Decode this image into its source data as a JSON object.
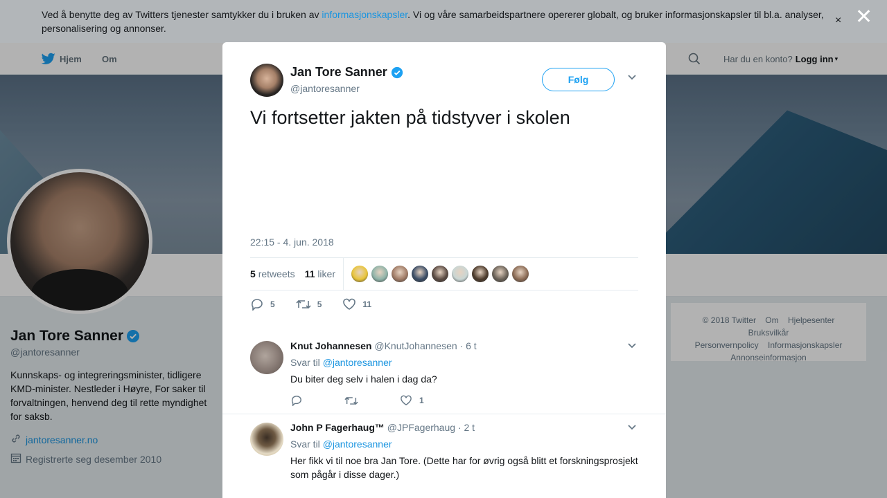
{
  "cookie_banner": {
    "text_before": "Ved å benytte deg av Twitters tjenester samtykker du i bruken av ",
    "link": "informasjonskapsler",
    "text_after": ". Vi og våre samarbeidspartnere opererer globalt, og bruker informasjonskapsler til bl.a. analyser, personalisering og annonser.",
    "close": "×"
  },
  "modal_close": "✕",
  "nav": {
    "home": "Hjem",
    "about": "Om",
    "have_account": "Har du en konto?",
    "login": "Logg inn",
    "caret": "▾"
  },
  "profile": {
    "name": "Jan Tore Sanner",
    "handle": "@jantoresanner",
    "bio": "Kunnskaps- og integreringsminister, tidligere KMD-minister. Nestleder i Høyre, For saker til forvaltningen, henvend deg til rette myndighet for saksb.",
    "url": "jantoresanner.no",
    "joined": "Registrerte seg desember 2010"
  },
  "footer": {
    "items": [
      "© 2018 Twitter",
      "Om",
      "Hjelpesenter",
      "Bruksvilkår",
      "Personvernpolicy",
      "Informasjonskapsler",
      "Annonseinformasjon"
    ]
  },
  "tweet": {
    "name": "Jan Tore Sanner",
    "handle": "@jantoresanner",
    "follow": "Følg",
    "text": "Vi fortsetter jakten på tidstyver i skolen",
    "time": "22:15 - 4. jun. 2018",
    "retweets_count": "5",
    "retweets_label": "retweets",
    "likes_count": "11",
    "likes_label": "liker",
    "reply_count": "5",
    "retweet_count": "5",
    "like_count": "11",
    "liker_colors": [
      "#e8c43a",
      "#8fb3a8",
      "#a07b66",
      "#3b4d66",
      "#5a4a42",
      "#c9d6d4",
      "#4d3b2c",
      "#6b6258",
      "#8b6b55"
    ]
  },
  "replies": [
    {
      "name": "Knut Johannesen",
      "handle": "@KnutJohannesen",
      "time": "· 6 t",
      "reply_to_label": "Svar til",
      "reply_to": "@jantoresanner",
      "text": "Du biter deg selv i halen i dag da?",
      "likes": "1",
      "avatar_color": "#8a7d77"
    },
    {
      "name": "John P Fagerhaug™",
      "handle": "@JPFagerhaug",
      "time": "· 2 t",
      "reply_to_label": "Svar til",
      "reply_to": "@jantoresanner",
      "text": "Her fikk vi til noe bra Jan Tore. (Dette har for øvrig også blitt et forskningsprosjekt som pågår i disse dager.)",
      "avatar_color": "#c9b78f"
    }
  ],
  "colors": {
    "accent": "#1da1f2",
    "link": "#1b95e0",
    "muted": "#657786"
  }
}
